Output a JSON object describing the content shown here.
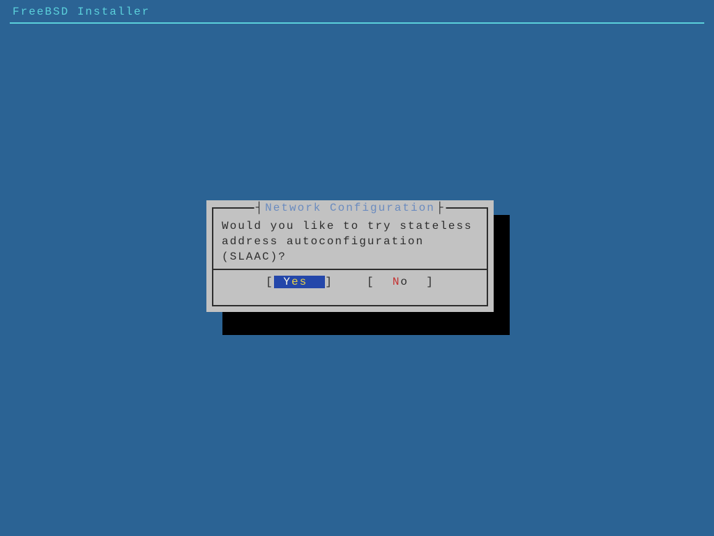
{
  "header": {
    "title": "FreeBSD Installer"
  },
  "dialog": {
    "title": "Network Configuration",
    "message_line1": "Would you like to try stateless",
    "message_line2": "address autoconfiguration",
    "message_line3": "(SLAAC)?",
    "buttons": {
      "yes": {
        "bracket_open": "[",
        "bracket_close": "]",
        "hotkey": "Y",
        "rest": "es",
        "selected": true
      },
      "no": {
        "bracket_open": "[",
        "bracket_close": "]",
        "hotkey": "N",
        "rest": "o",
        "selected": false
      }
    }
  }
}
